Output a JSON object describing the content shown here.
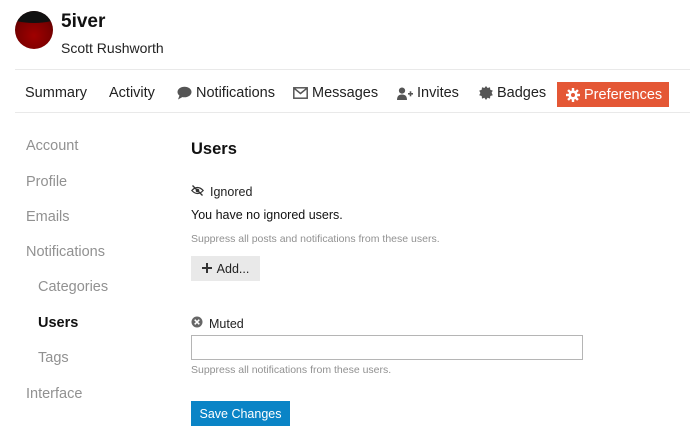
{
  "user": {
    "username": "5iver",
    "full_name": "Scott Rushworth"
  },
  "nav": {
    "items": [
      {
        "label": "Summary",
        "icon": ""
      },
      {
        "label": "Activity",
        "icon": ""
      },
      {
        "label": "Notifications",
        "icon": "speech-bubble-icon"
      },
      {
        "label": "Messages",
        "icon": "envelope-icon"
      },
      {
        "label": "Invites",
        "icon": "user-plus-icon"
      },
      {
        "label": "Badges",
        "icon": "certificate-icon"
      },
      {
        "label": "Preferences",
        "icon": "gear-icon",
        "active": true
      }
    ]
  },
  "sidebar": {
    "items": [
      {
        "label": "Account"
      },
      {
        "label": "Profile"
      },
      {
        "label": "Emails"
      },
      {
        "label": "Notifications"
      },
      {
        "label": "Categories"
      },
      {
        "label": "Users",
        "active": true
      },
      {
        "label": "Tags"
      },
      {
        "label": "Interface"
      }
    ]
  },
  "main": {
    "title": "Users",
    "ignored": {
      "label": "Ignored",
      "icon": "eye-slash-icon",
      "empty_text": "You have no ignored users.",
      "help": "Suppress all posts and notifications from these users.",
      "add_label": "Add..."
    },
    "muted": {
      "label": "Muted",
      "icon": "times-circle-icon",
      "value": "",
      "help": "Suppress all notifications from these users."
    },
    "save_label": "Save Changes"
  },
  "colors": {
    "accent": "#e45735",
    "primary_button": "#0a84c6",
    "muted_text": "#919191"
  }
}
